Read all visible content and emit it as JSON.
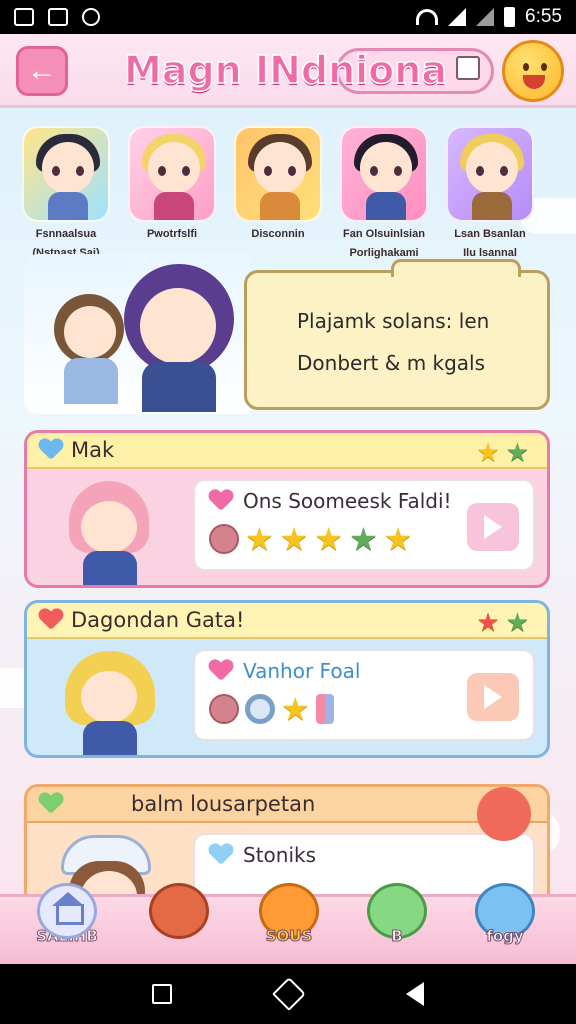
{
  "status_bar": {
    "time": "6:55",
    "icons": [
      "gallery-icon",
      "image-icon",
      "settings-icon",
      "wifi-icon",
      "signal-icon",
      "battery-icon"
    ]
  },
  "header": {
    "title": "Magn INdniona",
    "back_icon": "back-arrow-icon",
    "edit_icon": "pencil-icon",
    "profile_icon": "smiley-face-icon"
  },
  "characters": [
    {
      "label_line1": "Fsnnaalsua",
      "label_line2": "(Nstnast Sai)",
      "hair": "#2a2a3a"
    },
    {
      "label_line1": "Pwotrfslfi",
      "label_line2": "",
      "hair": "#f3d36a"
    },
    {
      "label_line1": "Disconnin",
      "label_line2": "",
      "hair": "#5a3c2c"
    },
    {
      "label_line1": "Fan Olsuinlsian",
      "label_line2": "Porlighakami",
      "hair": "#241c2c"
    },
    {
      "label_line1": "Lsan Bsanlan",
      "label_line2": "Ilu lsannal",
      "hair": "#f0cc5a"
    }
  ],
  "hero": {
    "line1": "Plajamk solans: len",
    "line2": "Donbert & m kgals"
  },
  "quests": [
    {
      "header": "Mak",
      "panel_title": "Ons Soomeesk Faldi!",
      "stars": 5,
      "button": "play-button"
    },
    {
      "header": "Dagondan Gata!",
      "panel_title": "Vanhor Foal",
      "button": "action-button"
    },
    {
      "header": "balm lousarpetan",
      "panel_title": "Stoniks"
    }
  ],
  "bottom_nav": [
    {
      "label": "SALIHB",
      "icon": "house-icon"
    },
    {
      "label": "",
      "icon": "fox-icon"
    },
    {
      "label": "SOUS",
      "icon": "orange-bear-icon"
    },
    {
      "label": "B",
      "icon": "green-bear-icon"
    },
    {
      "label": "fogy",
      "icon": "blue-mouse-icon"
    }
  ],
  "colors": {
    "accent_pink": "#f06aa6",
    "star_yellow": "#f6c31f",
    "star_green": "#62ad5a"
  }
}
